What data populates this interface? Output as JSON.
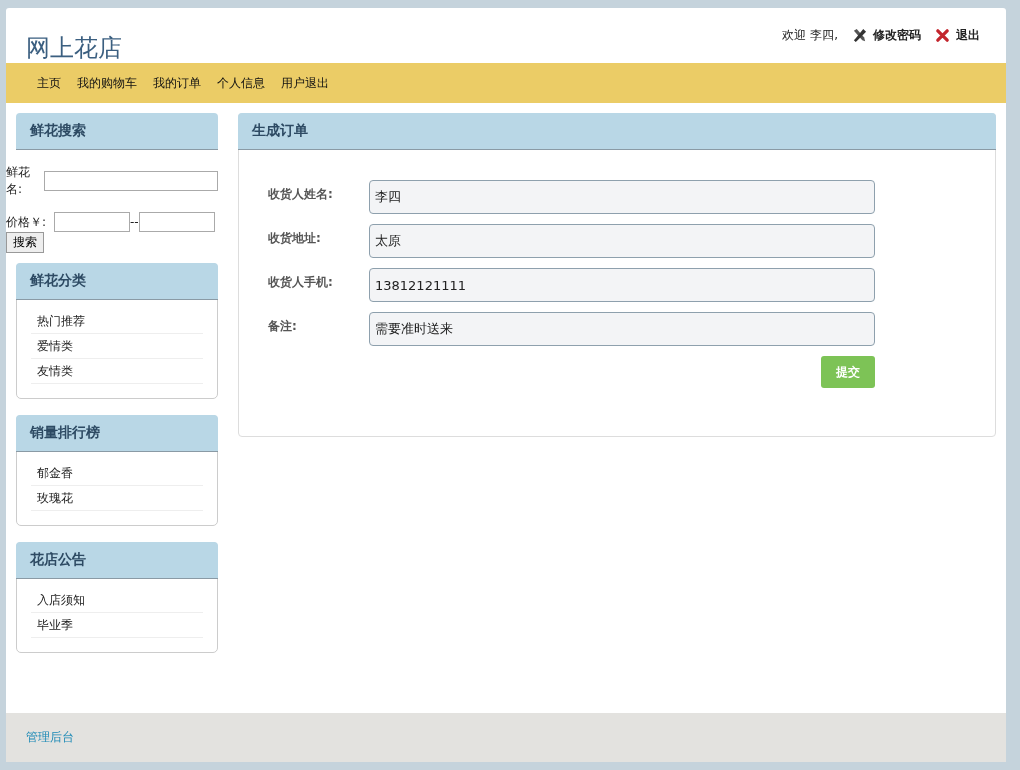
{
  "site_title": "网上花店",
  "user_bar": {
    "greeting": "欢迎 李四,",
    "links": [
      {
        "label": "修改密码",
        "kind": "tools"
      },
      {
        "label": "退出",
        "kind": "close"
      }
    ]
  },
  "nav": [
    "主页",
    "我的购物车",
    "我的订单",
    "个人信息",
    "用户退出"
  ],
  "search": {
    "title": "鲜花搜索",
    "name_label": "鲜花名:",
    "price_label": "价格￥:",
    "separator": "--",
    "button": "搜索"
  },
  "side_panels": [
    {
      "title": "鲜花分类",
      "items": [
        "热门推荐",
        "爱情类",
        "友情类"
      ]
    },
    {
      "title": "销量排行榜",
      "items": [
        "郁金香",
        "玫瑰花"
      ]
    },
    {
      "title": "花店公告",
      "items": [
        "入店须知",
        "毕业季"
      ]
    }
  ],
  "order": {
    "title": "生成订单",
    "fields": [
      {
        "label": "收货人姓名:",
        "value": "李四"
      },
      {
        "label": "收货地址:",
        "value": "太原"
      },
      {
        "label": "收货人手机:",
        "value": "13812121111"
      },
      {
        "label": "备注:",
        "value": "需要准时送来"
      }
    ],
    "submit": "提交"
  },
  "footer": {
    "link": "管理后台"
  }
}
